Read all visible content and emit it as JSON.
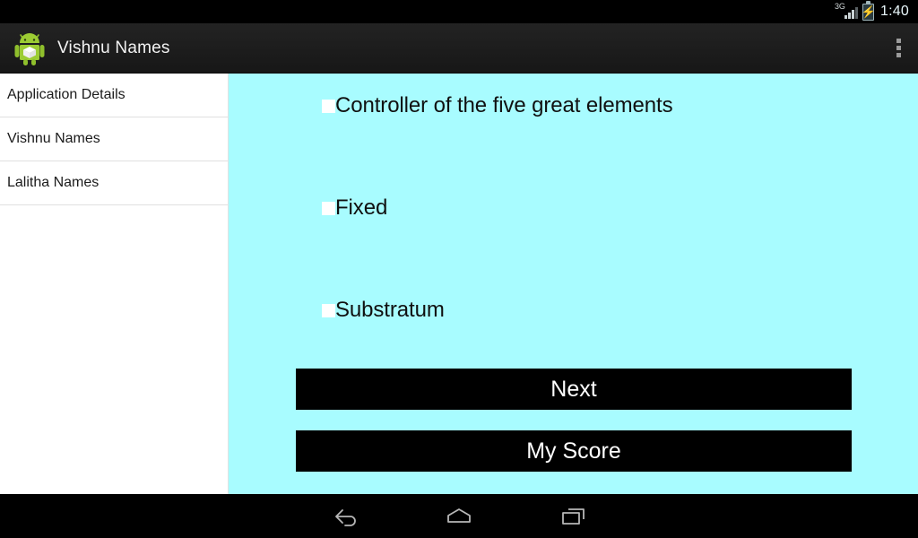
{
  "status_bar": {
    "network_type": "3G",
    "signal_icon": "signal-bars-icon",
    "battery_icon": "battery-charging-icon",
    "time": "1:40"
  },
  "action_bar": {
    "app_icon": "android-robot-icon",
    "title": "Vishnu Names",
    "overflow_icon": "overflow-menu-icon"
  },
  "sidebar": {
    "items": [
      {
        "label": "Application Details"
      },
      {
        "label": "Vishnu Names"
      },
      {
        "label": "Lalitha Names"
      }
    ]
  },
  "quiz": {
    "options": [
      {
        "label": "Controller of the five great elements",
        "selected": false
      },
      {
        "label": "Fixed",
        "selected": false
      },
      {
        "label": "Substratum",
        "selected": false
      }
    ],
    "next_label": "Next",
    "score_label": "My Score",
    "background_color": "#a8fcff",
    "button_color": "#000000",
    "button_text_color": "#ffffff"
  },
  "nav_bar": {
    "back_icon": "back-arrow-icon",
    "home_icon": "home-icon",
    "recents_icon": "recent-apps-icon"
  }
}
